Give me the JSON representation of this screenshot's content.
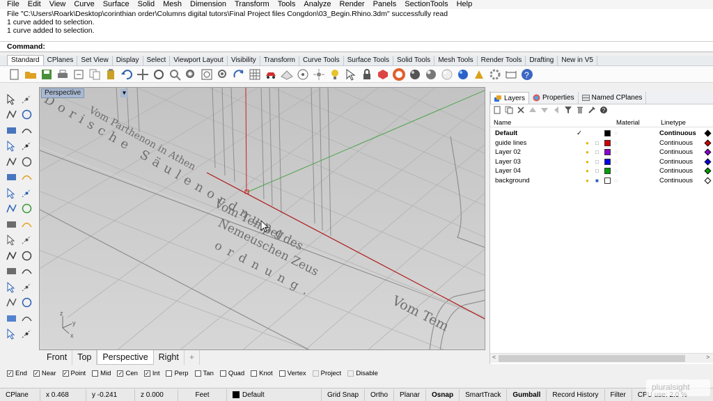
{
  "menu": [
    "File",
    "Edit",
    "View",
    "Curve",
    "Surface",
    "Solid",
    "Mesh",
    "Dimension",
    "Transform",
    "Tools",
    "Analyze",
    "Render",
    "Panels",
    "SectionTools",
    "Help"
  ],
  "history": [
    "File \"C:\\Users\\Roark\\Desktop\\corinthian order\\Columns digital tutors\\Final Project files Congdon\\03_Begin.Rhino.3dm\" successfully read",
    "1 curve added to selection.",
    "1 curve added to selection."
  ],
  "command": {
    "label": "Command:",
    "value": ""
  },
  "toolbar_tabs": [
    "Standard",
    "CPlanes",
    "Set View",
    "Display",
    "Select",
    "Viewport Layout",
    "Visibility",
    "Transform",
    "Curve Tools",
    "Surface Tools",
    "Solid Tools",
    "Mesh Tools",
    "Render Tools",
    "Drafting",
    "New in V5"
  ],
  "toolbar_icons": [
    "new-file-icon",
    "open-file-icon",
    "save-icon",
    "print-icon",
    "import-icon",
    "copy-icon",
    "paste-icon",
    "undo-icon",
    "pan-icon",
    "rotate-view-icon",
    "zoom-icon",
    "zoom-window-icon",
    "zoom-extents-icon",
    "zoom-selected-icon",
    "rotate-icon",
    "grid-icon",
    "car-icon",
    "cplane-icon",
    "circle-target-icon",
    "point-icon",
    "light-icon",
    "select-icon",
    "lock-icon",
    "material-icon",
    "color-wheel-icon",
    "sphere-shaded-icon",
    "sphere-rendered-icon",
    "sphere-ghost-icon",
    "globe-icon",
    "options-icon",
    "settings-icon",
    "dimension-icon",
    "help-icon"
  ],
  "viewport": {
    "label": "Perspective",
    "text_lines": [
      "Vom Parthenon in Athen",
      "Dorische Säulenordnung",
      "Vom Tempel des",
      "Nemeuschen Zeus",
      "ordnung.",
      "Vom Tem"
    ],
    "axes": {
      "z": "z",
      "y": "y",
      "x": "x"
    }
  },
  "viewport_tabs": [
    "Front",
    "Top",
    "Perspective",
    "Right",
    "+"
  ],
  "panel": {
    "tabs": [
      "Layers",
      "Properties",
      "Named CPlanes"
    ],
    "headers": {
      "name": "Name",
      "material": "Material",
      "linetype": "Linetype"
    },
    "layers": [
      {
        "name": "Default",
        "current": "✓",
        "color": "#000000",
        "linetype": "Continuous",
        "bold": true
      },
      {
        "name": "guide lines",
        "current": "",
        "color": "#d40000",
        "linetype": "Continuous",
        "bold": false
      },
      {
        "name": "Layer 02",
        "current": "",
        "color": "#8b00d4",
        "linetype": "Continuous",
        "bold": false
      },
      {
        "name": "Layer 03",
        "current": "",
        "color": "#0000e6",
        "linetype": "Continuous",
        "bold": false
      },
      {
        "name": "Layer 04",
        "current": "",
        "color": "#00a000",
        "linetype": "Continuous",
        "bold": false
      },
      {
        "name": "background",
        "current": "",
        "color": "#ffffff",
        "linetype": "Continuous",
        "bold": false
      }
    ]
  },
  "osnaps": [
    {
      "label": "End",
      "checked": true
    },
    {
      "label": "Near",
      "checked": true
    },
    {
      "label": "Point",
      "checked": true
    },
    {
      "label": "Mid",
      "checked": false
    },
    {
      "label": "Cen",
      "checked": true
    },
    {
      "label": "Int",
      "checked": true
    },
    {
      "label": "Perp",
      "checked": false
    },
    {
      "label": "Tan",
      "checked": false
    },
    {
      "label": "Quad",
      "checked": false
    },
    {
      "label": "Knot",
      "checked": false
    },
    {
      "label": "Vertex",
      "checked": false
    },
    {
      "label": "Project",
      "checked": false
    },
    {
      "label": "Disable",
      "checked": false
    }
  ],
  "status": {
    "cplane": "CPlane",
    "x": "x 0.468",
    "y": "y -0.241",
    "z": "z 0.000",
    "units": "Feet",
    "layer": "Default",
    "toggles": [
      {
        "label": "Grid Snap",
        "bold": false
      },
      {
        "label": "Ortho",
        "bold": false
      },
      {
        "label": "Planar",
        "bold": false
      },
      {
        "label": "Osnap",
        "bold": true
      },
      {
        "label": "SmartTrack",
        "bold": false
      },
      {
        "label": "Gumball",
        "bold": true
      },
      {
        "label": "Record History",
        "bold": false
      },
      {
        "label": "Filter",
        "bold": false
      }
    ],
    "cpu": "CPU use: 2.0 %"
  },
  "watermark": "pluralsight"
}
